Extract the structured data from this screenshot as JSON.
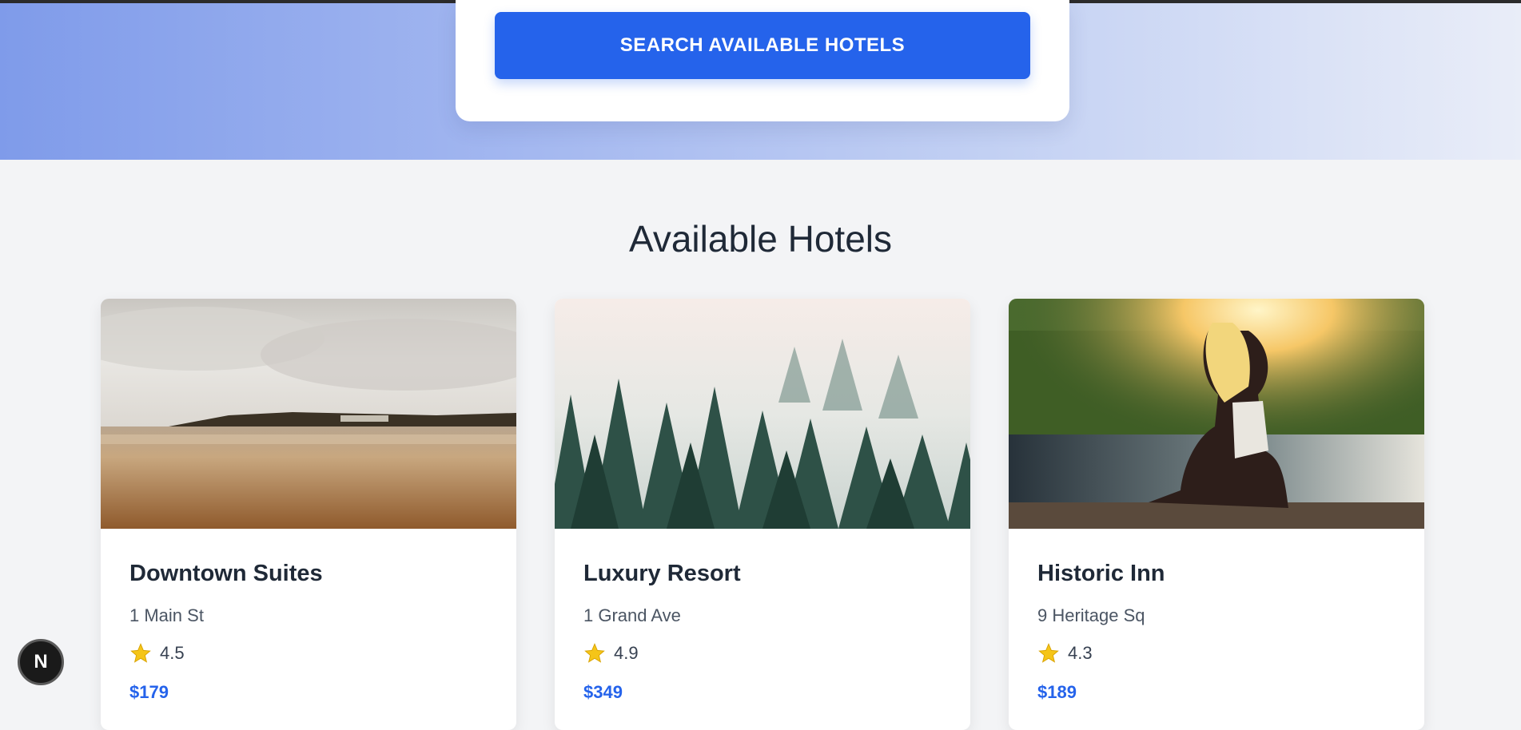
{
  "search": {
    "button_label": "SEARCH AVAILABLE HOTELS"
  },
  "section": {
    "title": "Available Hotels"
  },
  "hotels": [
    {
      "name": "Downtown Suites",
      "address": "1 Main St",
      "rating": "4.5",
      "price": "$179",
      "image": "beach-shore-photo"
    },
    {
      "name": "Luxury Resort",
      "address": "1 Grand Ave",
      "rating": "4.9",
      "price": "$349",
      "image": "misty-forest-photo"
    },
    {
      "name": "Historic Inn",
      "address": "9 Heritage Sq",
      "rating": "4.3",
      "price": "$189",
      "image": "sunset-lake-photo"
    }
  ],
  "badge": {
    "label": "N"
  },
  "colors": {
    "accent": "#2563eb",
    "star": "#f5c518"
  }
}
